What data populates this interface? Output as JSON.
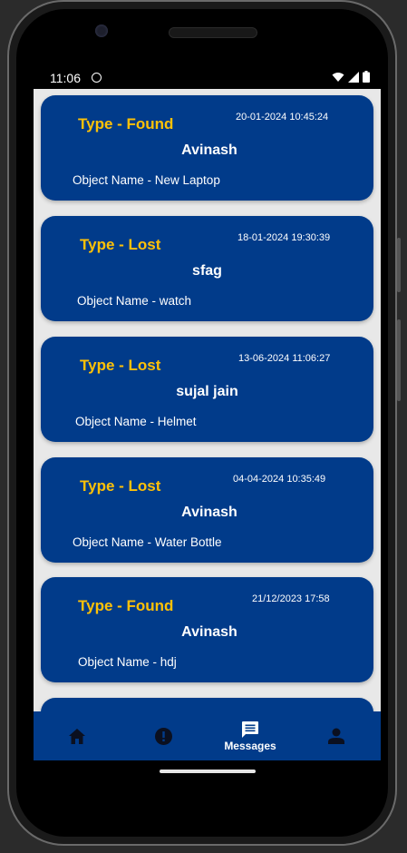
{
  "status_bar": {
    "time": "11:06"
  },
  "cards": [
    {
      "type": "Type - Found",
      "date": "20-01-2024 10:45:24",
      "user": "Avinash",
      "object": "Object Name - New Laptop"
    },
    {
      "type": "Type - Lost",
      "date": "18-01-2024 19:30:39",
      "user": "sfag",
      "object": "Object Name - watch"
    },
    {
      "type": "Type - Lost",
      "date": "13-06-2024 11:06:27",
      "user": "sujal jain",
      "object": "Object Name - Helmet"
    },
    {
      "type": "Type - Lost",
      "date": "04-04-2024 10:35:49",
      "user": "Avinash",
      "object": "Object Name - Water Bottle"
    },
    {
      "type": "Type - Found",
      "date": "21/12/2023 17:58",
      "user": "Avinash",
      "object": "Object Name - hdj"
    }
  ],
  "bottom_nav": {
    "items": [
      {
        "icon": "home-icon",
        "label": ""
      },
      {
        "icon": "alert-icon",
        "label": ""
      },
      {
        "icon": "message-icon",
        "label": "Messages"
      },
      {
        "icon": "person-icon",
        "label": ""
      }
    ]
  },
  "colors": {
    "card_bg": "#013b8a",
    "type_text": "#ffc107",
    "content_bg": "#e8e8e8"
  }
}
